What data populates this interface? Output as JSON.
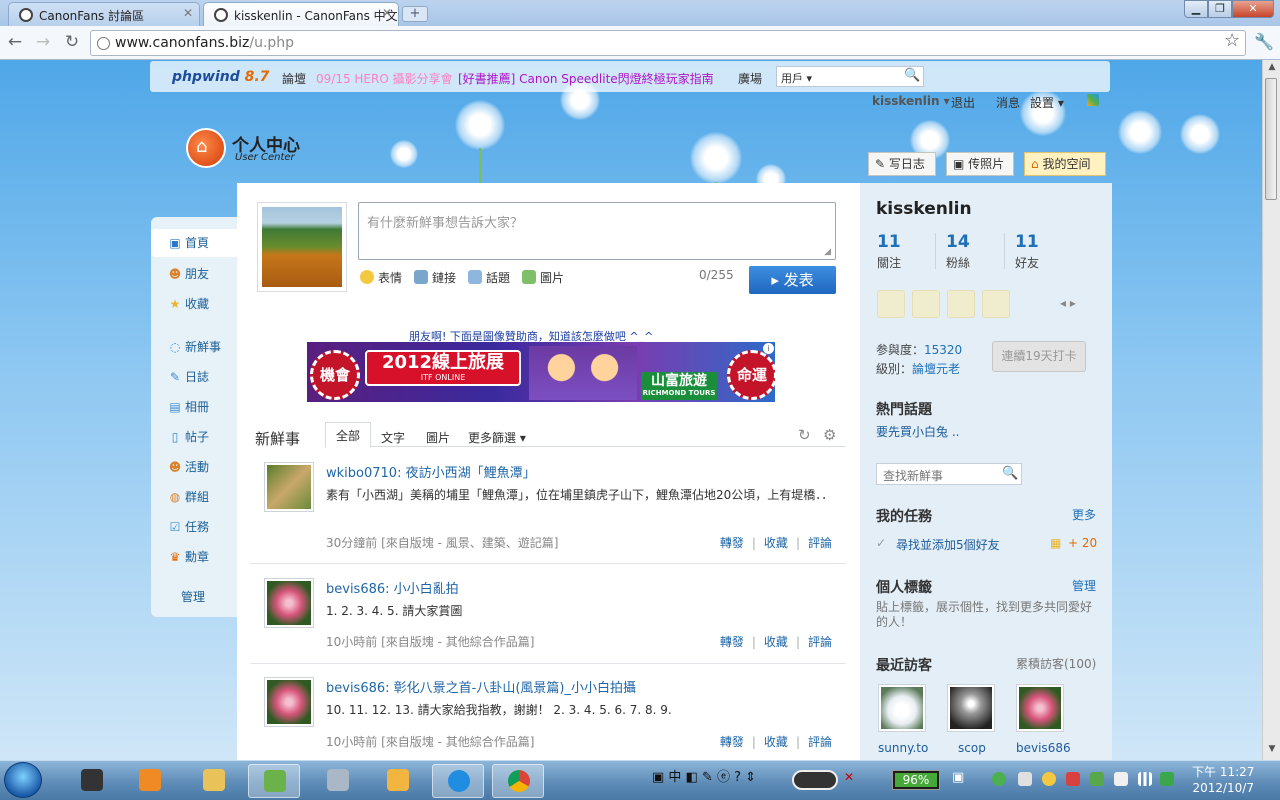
{
  "browser": {
    "tabs": [
      {
        "title": "CanonFans 討論區"
      },
      {
        "title": "kisskenlin - CanonFans 中文"
      }
    ],
    "new_tab": "+",
    "window_buttons": {
      "min": "▁",
      "max": "❐",
      "close": "✕"
    },
    "url_host": "www.canonfans.biz",
    "url_path": "/u.php"
  },
  "topnav": {
    "logo_name": "phpwind",
    "logo_version": "8.7",
    "items": [
      {
        "label": "論壇",
        "color": "#333333"
      },
      {
        "label": "09/15 HERO 攝影分享會",
        "color": "#ff7fbf"
      },
      {
        "label": "[好書推薦] Canon Speedlite閃燈終極玩家指南",
        "color": "#b014c8"
      },
      {
        "label": "廣場",
        "color": "#333333"
      }
    ],
    "search_scope": "用戶 ▾"
  },
  "usermenu": {
    "username": "kisskenlin ▾",
    "logout": "退出",
    "messages": "消息",
    "settings": "設置 ▾"
  },
  "usercenter": {
    "title": "个人中心",
    "subtitle": "User Center"
  },
  "leftnav": [
    {
      "label": "首頁",
      "icon": "home-icon"
    },
    {
      "label": "朋友",
      "icon": "friends-icon"
    },
    {
      "label": "收藏",
      "icon": "star-icon"
    },
    {
      "label": "新鮮事",
      "icon": "bubble-icon"
    },
    {
      "label": "日誌",
      "icon": "diary-icon"
    },
    {
      "label": "相冊",
      "icon": "album-icon"
    },
    {
      "label": "帖子",
      "icon": "post-icon"
    },
    {
      "label": "活動",
      "icon": "event-icon"
    },
    {
      "label": "群組",
      "icon": "group-icon"
    },
    {
      "label": "任務",
      "icon": "task-icon"
    },
    {
      "label": "勳章",
      "icon": "medal-icon"
    },
    {
      "label": "管理",
      "icon": ""
    }
  ],
  "composer": {
    "placeholder": "有什麼新鮮事想告訴大家？",
    "tools": [
      "表情",
      "鏈接",
      "話題",
      "圖片"
    ],
    "count": "0/255",
    "submit": "▸ 发表"
  },
  "ad": {
    "notice": "朋友啊! 下面是圖像贊助商，知道該怎麼做吧 ^_^",
    "left": "機會",
    "head": "2012線上旅展",
    "head_sub": "ITF ONLINE",
    "tour": "山富旅遊",
    "tour_sub": "RICHMOND TOURS",
    "right": "命運",
    "info": "i"
  },
  "feed": {
    "title": "新鮮事",
    "tabs": [
      "全部",
      "文字",
      "圖片",
      "更多篩選 ▾"
    ],
    "items": [
      {
        "user": "wkibo0710",
        "topic": "夜訪小西湖「鯉魚潭」",
        "body": "素有「小西湖」美稱的埔里「鯉魚潭」，位在埔里鎮虎子山下，鯉魚潭佔地20公頃，上有堤橋．．",
        "meta": "30分鐘前 [來自版塊 - 風景、建築、遊記篇]",
        "actions": [
          "轉發",
          "收藏",
          "評論"
        ],
        "thumb_color": "#c9a86a"
      },
      {
        "user": "bevis686",
        "topic": "小小白亂拍",
        "body": "1. 2. 3. 4. 5. 請大家賞圖",
        "meta": "10小時前 [來自版塊 - 其他綜合作品篇]",
        "actions": [
          "轉發",
          "收藏",
          "評論"
        ],
        "thumb_color": "#d7557a"
      },
      {
        "user": "bevis686",
        "topic": "彰化八景之首-八卦山(風景篇)_小小白拍攝",
        "body": "10. 11. 12. 13. 請大家給我指教，謝謝！ 2. 3. 4. 5. 6. 7. 8. 9.",
        "meta": "10小時前 [來自版塊 - 其他綜合作品篇]",
        "actions": [
          "轉發",
          "收藏",
          "評論"
        ],
        "thumb_color": "#d7557a"
      }
    ]
  },
  "rightpanel": {
    "buttons": [
      "写日志",
      "传照片",
      "我的空间"
    ],
    "name": "kisskenlin",
    "stats": [
      {
        "num": "11",
        "label": "關注"
      },
      {
        "num": "14",
        "label": "粉絲"
      },
      {
        "num": "11",
        "label": "好友"
      }
    ],
    "participation_label": "参與度：",
    "participation_value": "15320",
    "level_label": "級別：",
    "level_value": "論壇元老",
    "checkin": "連續19天打卡",
    "hot_title": "熱門話題",
    "hot_topic": "要先買小白兔 ..",
    "search_placeholder": "查找新鮮事",
    "tasks_title": "我的任務",
    "tasks_more": "更多",
    "task": "尋找並添加5個好友",
    "task_reward": "+ 20",
    "tags_title": "個人標籤",
    "tags_manage": "管理",
    "tags_desc": "貼上標籤，展示個性，找到更多共同愛好的人！",
    "visitors_title": "最近訪客",
    "visitors_total": "累積訪客(100)",
    "visitors": [
      {
        "name": "sunny.to",
        "color": "#e8eef2"
      },
      {
        "name": "scop",
        "color": "#6a6a6a"
      },
      {
        "name": "bevis686",
        "color": "#d7557a"
      }
    ]
  },
  "taskbar": {
    "ime": "中",
    "battery": "96%",
    "battery_level": 0.96,
    "time": "下午 11:27",
    "date": "2012/10/7"
  }
}
